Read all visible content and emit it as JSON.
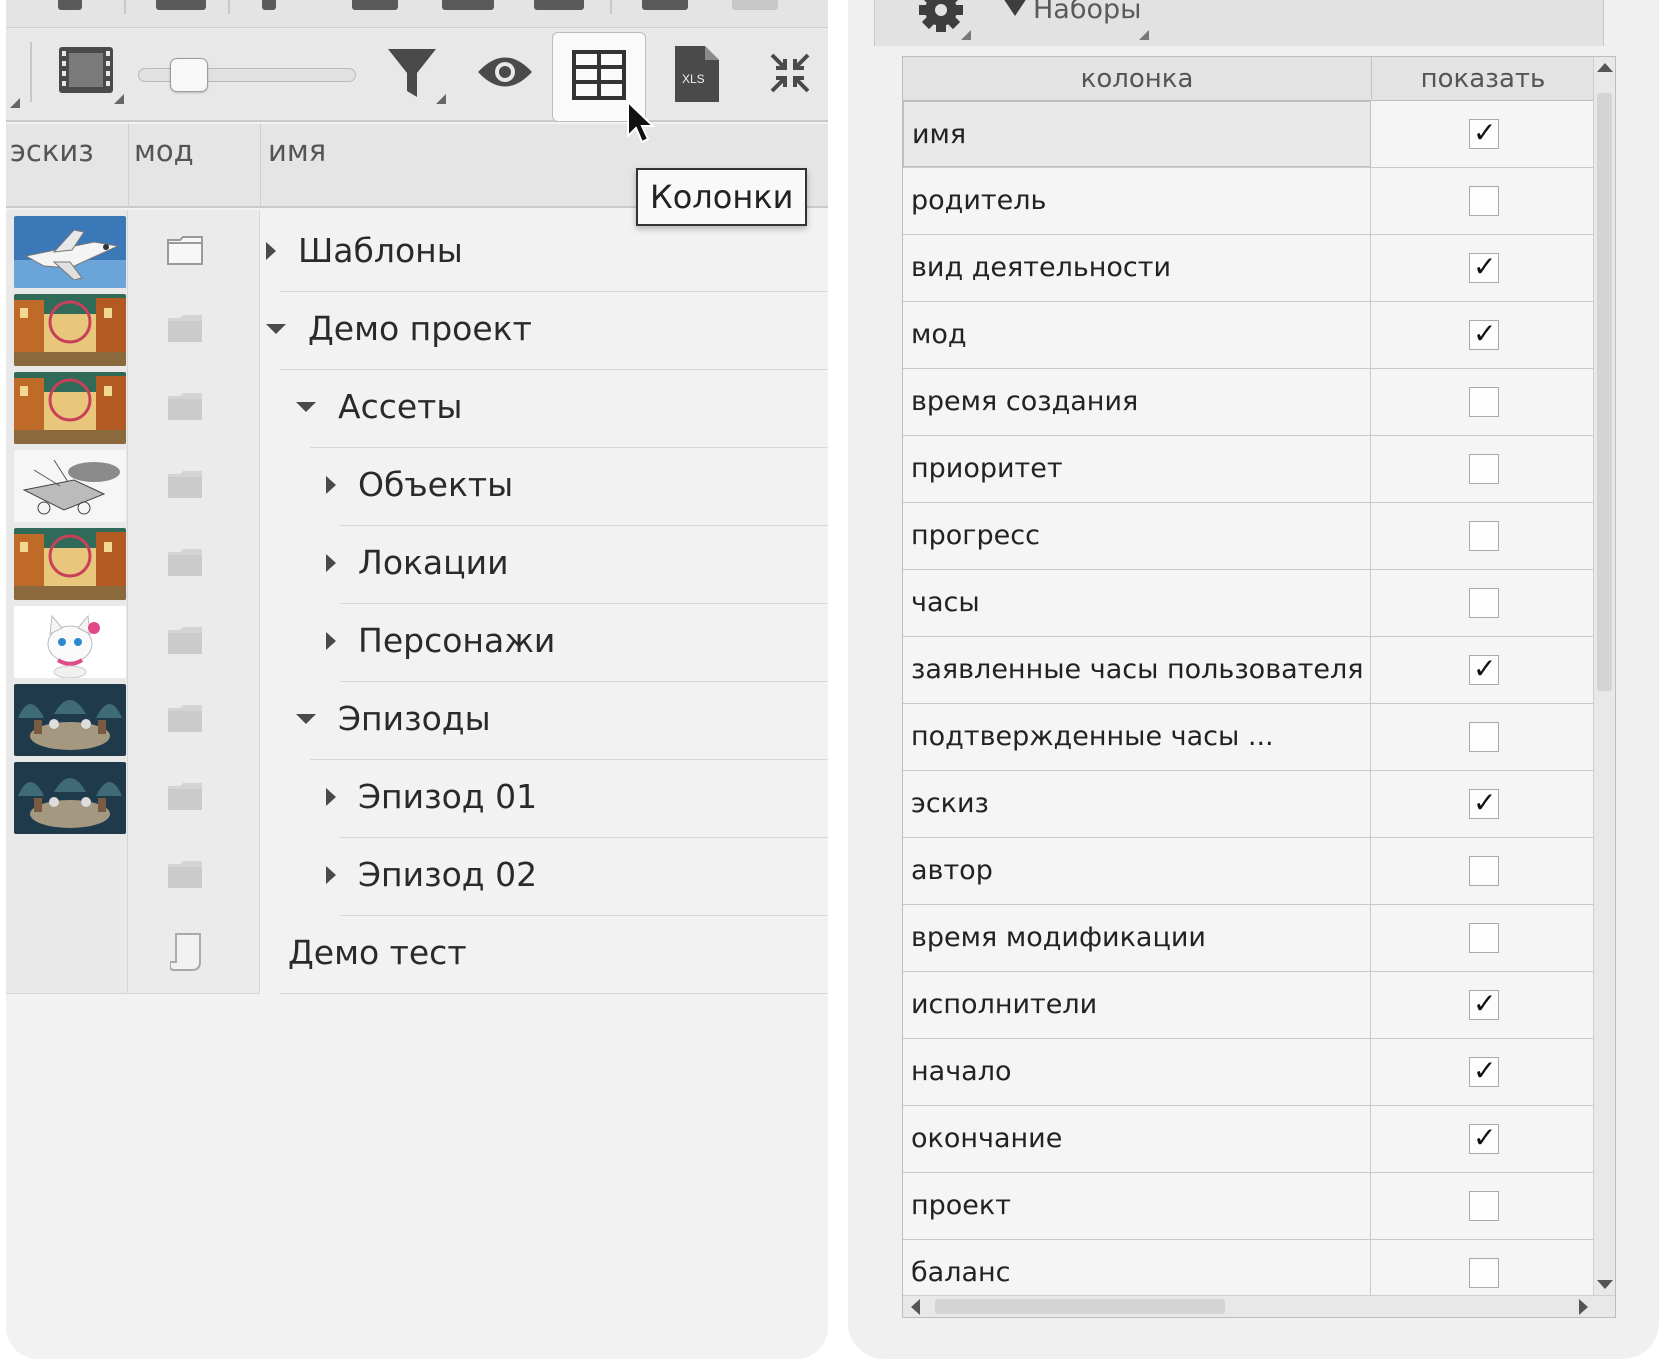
{
  "toolbar": {
    "tooltip": "Колонки",
    "xls_label": "XLS",
    "icons": [
      "film-icon",
      "zoom-slider",
      "filter-icon",
      "eye-icon",
      "columns-grid-icon",
      "xls-file-icon",
      "collapse-icon"
    ]
  },
  "tree": {
    "headers": {
      "thumb": "эскиз",
      "mod": "мод",
      "name": "имя"
    },
    "rows": [
      {
        "name": "Шаблоны",
        "level": 0,
        "arrow": "right",
        "thumb": "shuttle",
        "icon": "folder-outline"
      },
      {
        "name": "Демо проект",
        "level": 0,
        "arrow": "down",
        "thumb": "street",
        "icon": "folder"
      },
      {
        "name": "Ассеты",
        "level": 1,
        "arrow": "down",
        "thumb": "street",
        "icon": "folder"
      },
      {
        "name": "Объекты",
        "level": 2,
        "arrow": "right",
        "thumb": "sketch",
        "icon": "folder"
      },
      {
        "name": "Локации",
        "level": 2,
        "arrow": "right",
        "thumb": "street",
        "icon": "folder"
      },
      {
        "name": "Персонажи",
        "level": 2,
        "arrow": "right",
        "thumb": "cat",
        "icon": "folder"
      },
      {
        "name": "Эпизоды",
        "level": 1,
        "arrow": "down",
        "thumb": "room",
        "icon": "folder"
      },
      {
        "name": "Эпизод 01",
        "level": 2,
        "arrow": "right",
        "thumb": "room",
        "icon": "folder"
      },
      {
        "name": "Эпизод 02",
        "level": 2,
        "arrow": "right",
        "thumb": "",
        "icon": "folder"
      },
      {
        "name": "Демо тест",
        "level": 0,
        "arrow": "",
        "thumb": "",
        "icon": "scroll"
      }
    ]
  },
  "columns_panel": {
    "sets_label": "Наборы",
    "headers": {
      "column": "колонка",
      "show": "показать"
    },
    "rows": [
      {
        "label": "имя",
        "checked": true
      },
      {
        "label": "родитель",
        "checked": false
      },
      {
        "label": "вид деятельности",
        "checked": true
      },
      {
        "label": "мод",
        "checked": true
      },
      {
        "label": "время создания",
        "checked": false
      },
      {
        "label": "приоритет",
        "checked": false
      },
      {
        "label": "прогресс",
        "checked": false
      },
      {
        "label": "часы",
        "checked": false
      },
      {
        "label": "заявленные часы пользователя",
        "checked": true
      },
      {
        "label": "подтвержденные часы ...",
        "checked": false
      },
      {
        "label": "эскиз",
        "checked": true
      },
      {
        "label": "автор",
        "checked": false
      },
      {
        "label": "время модификации",
        "checked": false
      },
      {
        "label": "исполнители",
        "checked": true
      },
      {
        "label": "начало",
        "checked": true
      },
      {
        "label": "окончание",
        "checked": true
      },
      {
        "label": "проект",
        "checked": false
      },
      {
        "label": "баланс",
        "checked": false
      }
    ]
  }
}
